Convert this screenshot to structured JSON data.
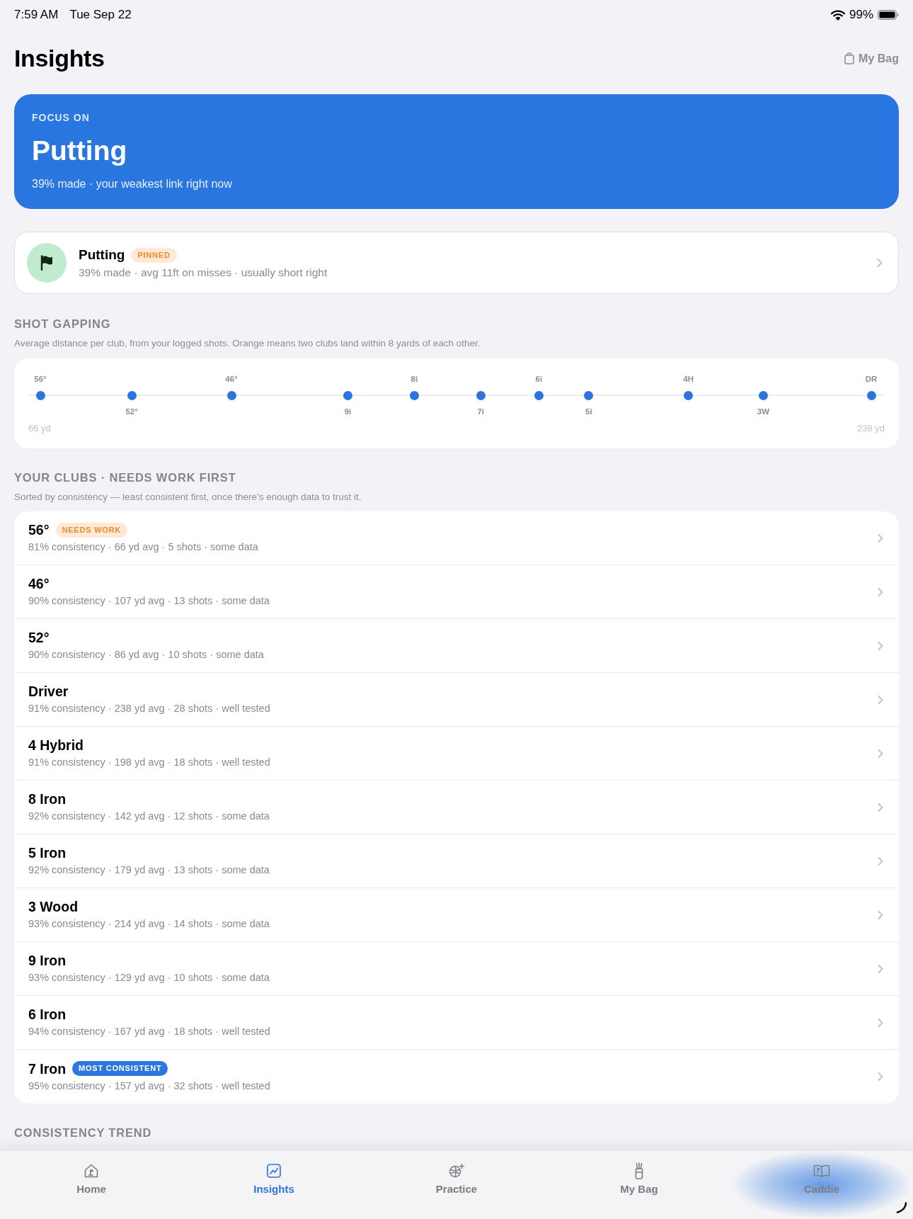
{
  "status_bar": {
    "time": "7:59 AM",
    "date": "Tue Sep 22",
    "battery": "99%"
  },
  "header": {
    "title": "Insights",
    "bag_link": "My Bag"
  },
  "focus_card": {
    "eyebrow": "FOCUS ON",
    "title": "Putting",
    "subtitle": "39% made · your weakest link right now"
  },
  "pinned_card": {
    "title": "Putting",
    "badge": {
      "kind": "warning",
      "text": "PINNED"
    },
    "subtitle": "39% made · avg 11ft on misses · usually short right"
  },
  "shot_gapping": {
    "title": "SHOT GAPPING",
    "description": "Average distance per club, from your logged shots. Orange means two clubs land within 8 yards of each other.",
    "markers": [
      {
        "label": "56°",
        "level": 0
      },
      {
        "label": "52°",
        "level": 0.11
      },
      {
        "label": "46°",
        "level": 0.23
      },
      {
        "label": "9i",
        "level": 0.37
      },
      {
        "label": "8i",
        "level": 0.45
      },
      {
        "label": "7i",
        "level": 0.53
      },
      {
        "label": "6i",
        "level": 0.6
      },
      {
        "label": "5i",
        "level": 0.66
      },
      {
        "label": "4H",
        "level": 0.78
      },
      {
        "label": "3W",
        "level": 0.87
      },
      {
        "label": "DR",
        "level": 1
      }
    ],
    "min_label": "66 yd",
    "max_label": "238 yd"
  },
  "clubs": {
    "title": "YOUR CLUBS · NEEDS WORK FIRST",
    "description": "Sorted by consistency — least consistent first, once there’s enough data to trust it.",
    "rows": [
      {
        "name": "56°",
        "badge": {
          "kind": "warning",
          "text": "NEEDS WORK"
        },
        "detail": "81% consistency · 66 yd avg · 5 shots · some data"
      },
      {
        "name": "46°",
        "detail": "90% consistency · 107 yd avg · 13 shots · some data"
      },
      {
        "name": "52°",
        "detail": "90% consistency · 86 yd avg · 10 shots · some data"
      },
      {
        "name": "Driver",
        "detail": "91% consistency · 238 yd avg · 28 shots · well tested"
      },
      {
        "name": "4 Hybrid",
        "detail": "91% consistency · 198 yd avg · 18 shots · well tested"
      },
      {
        "name": "8 Iron",
        "detail": "92% consistency · 142 yd avg · 12 shots · some data"
      },
      {
        "name": "5 Iron",
        "detail": "92% consistency · 179 yd avg · 13 shots · some data"
      },
      {
        "name": "3 Wood",
        "detail": "93% consistency · 214 yd avg · 14 shots · some data"
      },
      {
        "name": "9 Iron",
        "detail": "93% consistency · 129 yd avg · 10 shots · some data"
      },
      {
        "name": "6 Iron",
        "detail": "94% consistency · 167 yd avg · 18 shots · well tested"
      },
      {
        "name": "7 Iron",
        "badge": {
          "kind": "highlight",
          "text": "MOST CONSISTENT"
        },
        "detail": "95% consistency · 157 yd avg · 32 shots · well tested"
      }
    ]
  },
  "consistency_trend": {
    "title": "CONSISTENCY TREND"
  },
  "tab_bar": {
    "tabs": [
      {
        "label": "Home",
        "selected": false,
        "pressed": false
      },
      {
        "label": "Insights",
        "selected": true,
        "pressed": false
      },
      {
        "label": "Practice",
        "selected": false,
        "pressed": false
      },
      {
        "label": "My Bag",
        "selected": false,
        "pressed": false
      },
      {
        "label": "Caddie",
        "selected": false,
        "pressed": true
      }
    ]
  }
}
